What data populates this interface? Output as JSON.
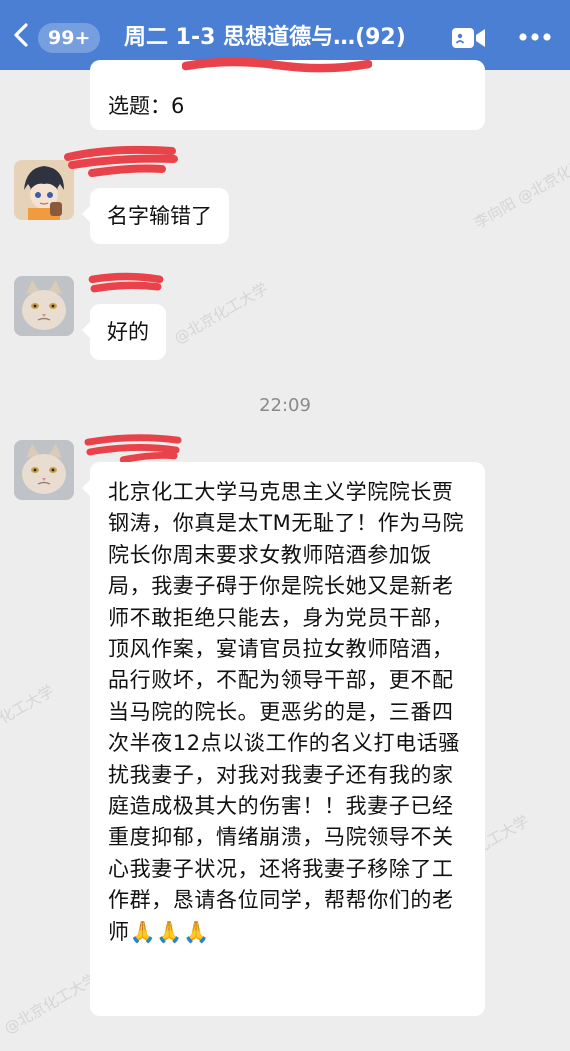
{
  "header": {
    "unread_badge": "99+",
    "title": "周二 1-3 思想道德与…(92)",
    "back_icon": "chevron-left-icon",
    "video_icon": "video-call-icon",
    "more_icon": "more-dots-icon",
    "background_color": "#4a7fd4"
  },
  "messages": [
    {
      "text": "选题：6"
    },
    {
      "text": "名字输错了",
      "avatar": "anime-avatar"
    },
    {
      "text": "好的",
      "avatar": "cat-avatar"
    },
    {
      "timestamp": "22:09"
    },
    {
      "text": "北京化工大学马克思主义学院院长贾钢涛，你真是太TM无耻了！作为马院院长你周末要求女教师陪酒参加饭局，我妻子碍于你是院长她又是新老师不敢拒绝只能去，身为党员干部，顶风作案，宴请官员拉女教师陪酒，品行败坏，不配为领导干部，更不配当马院的院长。更恶劣的是，三番四次半夜12点以谈工作的名义打电话骚扰我妻子，对我对我妻子还有我的家庭造成极其大的伤害！！我妻子已经重度抑郁，情绪崩溃，马院领导不关心我妻子状况，还将我妻子移除了工作群，恳请各位同学，帮帮你们的老师",
      "emoji": "🙏🙏🙏",
      "avatar": "cat-avatar"
    }
  ],
  "watermarks": [
    "李向阳 @北京化工大学",
    "@北京化工大学",
    "化工大学"
  ],
  "colors": {
    "chat_bg": "#ededed",
    "bubble_bg": "#ffffff",
    "redaction": "#e8424a"
  }
}
